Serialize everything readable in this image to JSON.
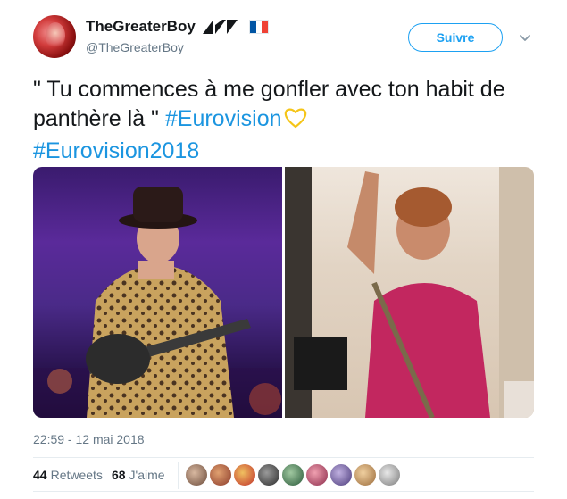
{
  "tweet": {
    "display_name": "TheGreaterBoy",
    "handle": "@TheGreaterBoy",
    "follow_label": "Suivre",
    "text_part1": "\" Tu commences à me gonfler avec ton habit de panthère là \" ",
    "hashtag1": "#Eurovision",
    "hashtag2": "#Eurovision2018",
    "timestamp": "22:59 - 12 mai 2018",
    "retweets_count": "44",
    "retweets_label": "Retweets",
    "likes_count": "68",
    "likes_label": "J'aime"
  },
  "icons": {
    "caret": "chevron-down-icon",
    "heart": "yellow-heart-emoji",
    "flag": "france-flag-emoji"
  },
  "colors": {
    "link": "#1b95e0",
    "follow": "#1da1f2",
    "secondary_text": "#657786",
    "heart": "#f5c518",
    "flag_blue": "#0055a4",
    "flag_white": "#ffffff",
    "flag_red": "#ef4135"
  }
}
